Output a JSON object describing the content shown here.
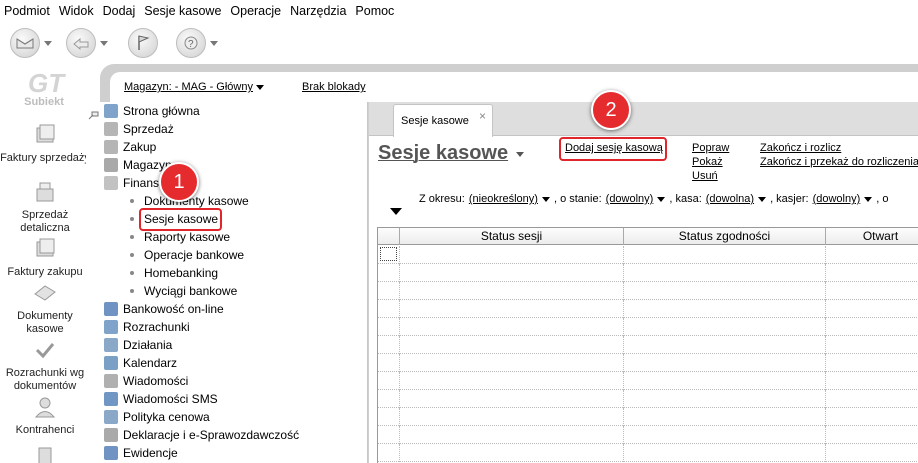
{
  "menu": [
    "Podmiot",
    "Widok",
    "Dodaj",
    "Sesje kasowe",
    "Operacje",
    "Narzędzia",
    "Pomoc"
  ],
  "app": {
    "logo_text": "Subiekt"
  },
  "leftbar": [
    {
      "label": "Faktury sprzedaży"
    },
    {
      "label": "Sprzedaż detaliczna"
    },
    {
      "label": "Faktury zakupu"
    },
    {
      "label": "Dokumenty kasowe"
    },
    {
      "label": "Rozrachunki wg dokumentów"
    },
    {
      "label": "Kontrahenci"
    }
  ],
  "header": {
    "magazyn_label": "Magazyn: - MAG - Główny",
    "blokada_label": "Brak blokady"
  },
  "nav": {
    "items": [
      {
        "label": "Strona główna"
      },
      {
        "label": "Sprzedaż"
      },
      {
        "label": "Zakup"
      },
      {
        "label": "Magazyn"
      },
      {
        "label": "Finanse"
      }
    ],
    "sub_items": [
      {
        "label": "Dokumenty kasowe"
      },
      {
        "label": "Sesje kasowe"
      },
      {
        "label": "Raporty kasowe"
      },
      {
        "label": "Operacje bankowe"
      },
      {
        "label": "Homebanking"
      },
      {
        "label": "Wyciągi bankowe"
      }
    ],
    "items2": [
      {
        "label": "Bankowość on-line"
      },
      {
        "label": "Rozrachunki"
      },
      {
        "label": "Działania"
      },
      {
        "label": "Kalendarz"
      },
      {
        "label": "Wiadomości"
      },
      {
        "label": "Wiadomości SMS"
      },
      {
        "label": "Polityka cenowa"
      },
      {
        "label": "Deklaracje i e-Sprawozdawczość"
      },
      {
        "label": "Ewidencje"
      }
    ]
  },
  "badges": {
    "one": "1",
    "two": "2"
  },
  "tab": {
    "label": "Sesje kasowe",
    "close": "×"
  },
  "page_title": "Sesje kasowe",
  "actions": {
    "add": "Dodaj sesję kasową",
    "edit": "Popraw",
    "show": "Pokaż",
    "delete": "Usuń",
    "close_settle": "Zakończ i rozlicz",
    "close_pass": "Zakończ i przekaż do rozliczenia"
  },
  "filters": {
    "period_label": "Z okresu:",
    "period_value": "(nieokreślony)",
    "state_label": ", o stanie:",
    "state_value": "(dowolny)",
    "cash_label": ", kasa:",
    "cash_value": "(dowolna)",
    "cashier_label": ", kasjer:",
    "cashier_value": "(dowolny)",
    "tail": ", o"
  },
  "grid": {
    "columns": [
      "Status sesji",
      "Status zgodności",
      "Otwart"
    ]
  }
}
